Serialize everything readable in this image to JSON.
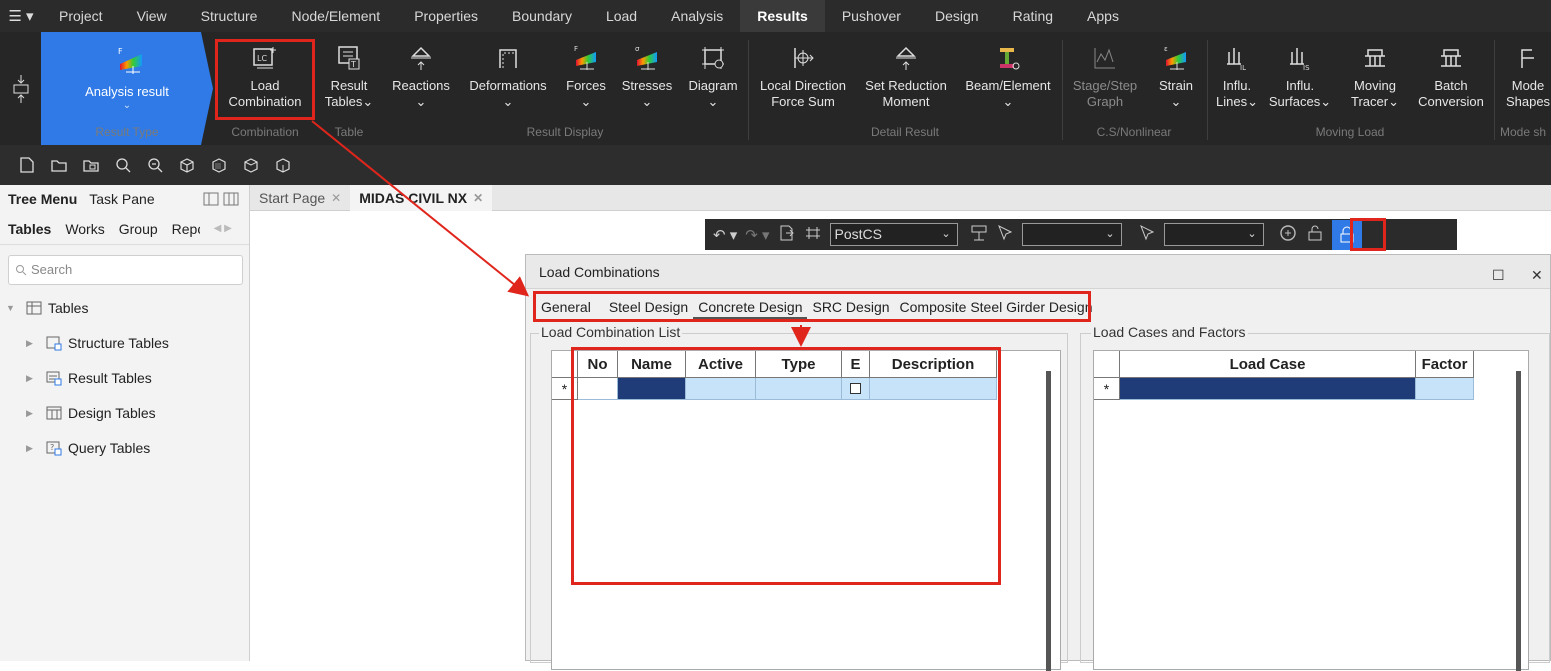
{
  "menubar": {
    "hamburger": "☰ ▾",
    "items": [
      "Project",
      "View",
      "Structure",
      "Node/Element",
      "Properties",
      "Boundary",
      "Load",
      "Analysis",
      "Results",
      "Pushover",
      "Design",
      "Rating",
      "Apps"
    ],
    "active": "Results"
  },
  "ribbon": {
    "analysis_result": "Analysis result",
    "buttons": [
      {
        "line1": "Load",
        "line2": "Combination"
      },
      {
        "line1": "Result",
        "line2": "Tables⌄"
      },
      {
        "line1": "Reactions",
        "line2": "⌄"
      },
      {
        "line1": "Deformations",
        "line2": "⌄"
      },
      {
        "line1": "Forces",
        "line2": "⌄"
      },
      {
        "line1": "Stresses",
        "line2": "⌄"
      },
      {
        "line1": "Diagram",
        "line2": "⌄"
      },
      {
        "line1": "Local Direction",
        "line2": "Force Sum"
      },
      {
        "line1": "Set Reduction",
        "line2": "Moment"
      },
      {
        "line1": "Beam/Element",
        "line2": "⌄"
      },
      {
        "line1": "Stage/Step",
        "line2": "Graph"
      },
      {
        "line1": "Strain",
        "line2": "⌄"
      },
      {
        "line1": "Influ.",
        "line2": "Lines⌄"
      },
      {
        "line1": "Influ.",
        "line2": "Surfaces⌄"
      },
      {
        "line1": "Moving",
        "line2": "Tracer⌄"
      },
      {
        "line1": "Batch",
        "line2": "Conversion"
      },
      {
        "line1": "Mode",
        "line2": "Shapes"
      }
    ],
    "groups": [
      "Result Type",
      "Combination",
      "Table",
      "Result Display",
      "Detail Result",
      "C.S/Nonlinear",
      "Moving Load",
      "Mode sh"
    ]
  },
  "sidebar": {
    "tabs": [
      "Tree Menu",
      "Task Pane"
    ],
    "subtabs": [
      "Tables",
      "Works",
      "Group",
      "Repo"
    ],
    "search_placeholder": "Search",
    "root": "Tables",
    "items": [
      "Structure Tables",
      "Result Tables",
      "Design Tables",
      "Query Tables"
    ]
  },
  "doc_tabs": [
    "Start Page",
    "MIDAS CIVIL NX"
  ],
  "toolbar2": {
    "stage": "PostCS"
  },
  "dialog": {
    "title": "Load Combinations",
    "tabs": [
      "General",
      "Steel Design",
      "Concrete Design",
      "SRC Design",
      "Composite Steel Girder Design"
    ],
    "active_tab": "Concrete Design",
    "list_title": "Load Combination List",
    "list_columns": [
      "No",
      "Name",
      "Active",
      "Type",
      "E",
      "Description"
    ],
    "factors_title": "Load Cases and Factors",
    "factor_columns": [
      "Load Case",
      "Factor"
    ],
    "new_row_marker": "*"
  },
  "colors": {
    "highlight": "#e0261c",
    "accent": "#2f7ae6",
    "selected_cell": "#1f3b78",
    "cell": "#c6e3fa"
  }
}
